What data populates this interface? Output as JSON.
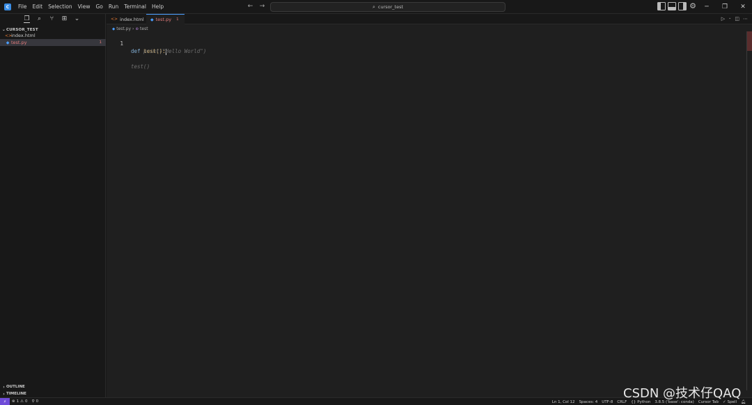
{
  "titlebar": {
    "logo_text": "C",
    "menu": [
      "File",
      "Edit",
      "Selection",
      "View",
      "Go",
      "Run",
      "Terminal",
      "Help"
    ],
    "search_text": "cursor_test"
  },
  "sidebar": {
    "explorer_title": "CURSOR_TEST",
    "files": [
      {
        "name": "index.html",
        "icon": "html-file-icon",
        "color": "#e37933",
        "badge": ""
      },
      {
        "name": "test.py",
        "icon": "python-file-icon",
        "color": "#e07a7a",
        "badge": "1"
      }
    ],
    "outline_label": "OUTLINE",
    "timeline_label": "TIMELINE"
  },
  "tabs": [
    {
      "label": "index.html",
      "color": "#cccccc"
    },
    {
      "label": "test.py",
      "color": "#e07a7a",
      "badge": "1"
    }
  ],
  "breadcrumb": {
    "file": "test.py",
    "symbol": "test"
  },
  "code": {
    "line_number": "1",
    "def_kw": "def",
    "fn_name": "test",
    "fn_parens": "():",
    "ghost_line2": "print(\"Hello World\")",
    "ghost_line4": "test()"
  },
  "statusbar": {
    "errors": "1",
    "warnings": "0",
    "ports": "0",
    "position": "Ln 1, Col 12",
    "spaces": "Spaces: 4",
    "encoding": "UTF-8",
    "eol": "CRLF",
    "language": "Python",
    "interpreter": "3.8.5 ('base': conda)",
    "cursor_tab": "Cursor Tab",
    "spell": "Spell"
  },
  "watermark": "CSDN @技术仔QAQ",
  "colors": {
    "accent": "#4a9eff",
    "remote": "#6f4bd8",
    "error": "#e07a7a"
  }
}
